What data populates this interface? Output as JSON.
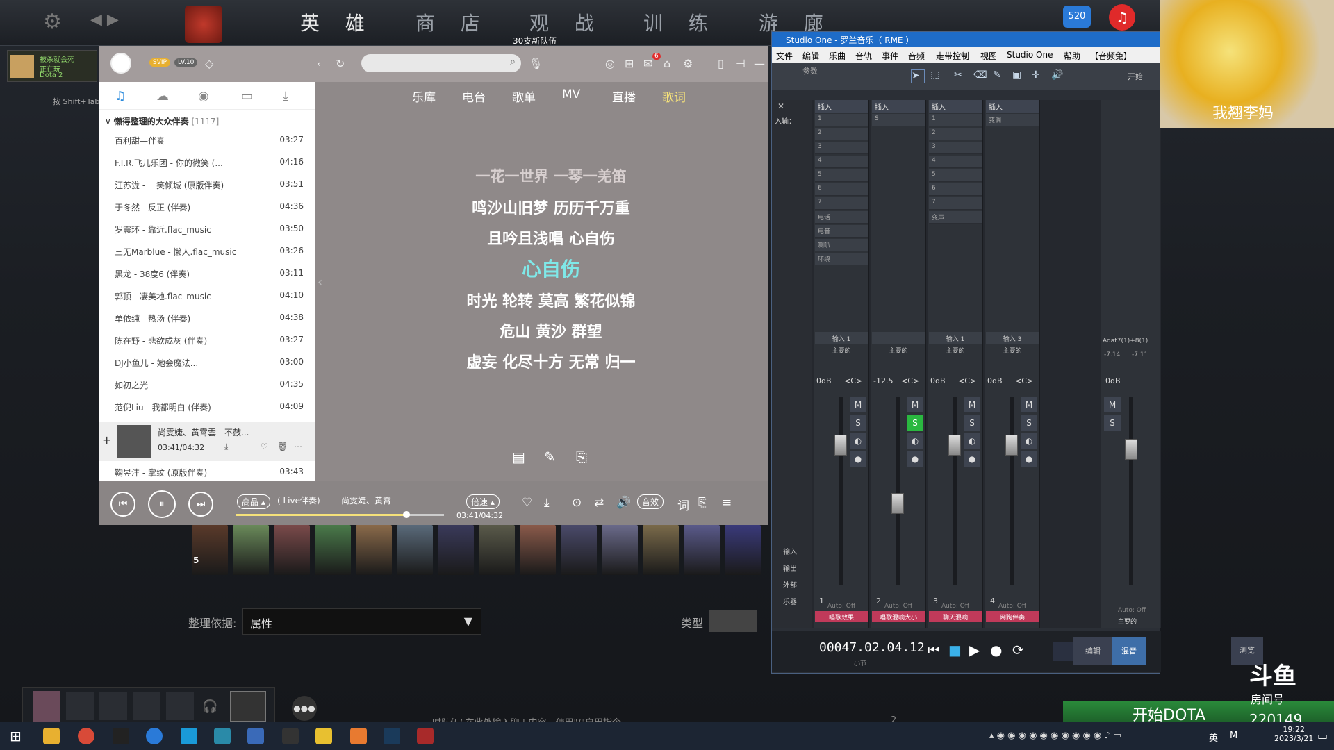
{
  "game": {
    "tabs": [
      "英 雄",
      "商 店",
      "观 战",
      "训 练",
      "游 廊"
    ],
    "player": {
      "line1": "被杀就会死",
      "line2": "正在玩",
      "line3": "Dota 2"
    },
    "shift_tab": "按 Shift+Tab 键",
    "news_badge": "30支新队伍",
    "sort_label": "整理依据:",
    "sort_value": "属性",
    "type_label": "类型",
    "chat_hint": "时队伍/ 在此处输入聊天内容，使用\"/\"启用指令",
    "start_button": "开始DOTA",
    "hero_count_badge": "5",
    "party_counts": [
      "2"
    ]
  },
  "stream": {
    "webcam_caption": "我翘李妈",
    "watermark": "斗鱼",
    "room_label": "房间号",
    "room_no": "220149",
    "badge_520": "520"
  },
  "music": {
    "header": {
      "svip": "SVIP",
      "level": "LV.10",
      "notif_count": "6"
    },
    "nav": [
      "乐库",
      "电台",
      "歌单",
      "MV",
      "直播",
      "歌词"
    ],
    "nav_active": 5,
    "playlist_title": "懒得整理的大众伴奏",
    "playlist_count": "[1117]",
    "songs": [
      {
        "name": "百利甜—伴奏",
        "dur": "03:27"
      },
      {
        "name": "F.I.R.飞儿乐团 - 你的微笑 (...",
        "dur": "04:16"
      },
      {
        "name": "汪苏泷 - 一笑倾城 (原版伴奏)",
        "dur": "03:51"
      },
      {
        "name": "于冬然 - 反正 (伴奏)",
        "dur": "04:36"
      },
      {
        "name": "罗震环 - 靠近.flac_music",
        "dur": "03:50"
      },
      {
        "name": "三无Marblue - 懒人.flac_music",
        "dur": "03:26"
      },
      {
        "name": "黑龙 - 38度6 (伴奏)",
        "dur": "03:11"
      },
      {
        "name": "郭顶 - 凄美地.flac_music",
        "dur": "04:10"
      },
      {
        "name": "单依纯 - 热汤 (伴奏)",
        "dur": "04:38"
      },
      {
        "name": "陈在野 - 悲欲成灰 (伴奏)",
        "dur": "03:27"
      },
      {
        "name": "DJ小鱼儿 - 她会魔法...",
        "dur": "03:00"
      },
      {
        "name": "如初之光",
        "dur": "04:35"
      },
      {
        "name": "范倪Liu - 我都明白 (伴奏)",
        "dur": "04:09"
      }
    ],
    "now_playing": {
      "name": "尚雯婕、黄霄雲 - 不鼓...",
      "time": "03:41/04:32"
    },
    "last_song": {
      "name": "鞠昱沣 - 掌纹 (原版伴奏)",
      "dur": "03:43"
    },
    "lyrics": [
      "一花一世界 一琴一羌笛",
      "鸣沙山旧梦 历历千万重",
      "且吟且浅唱 心自伤",
      "心自伤",
      "时光 轮转 莫高 繁花似锦",
      "危山 黄沙 群望",
      "虚妄 化尽十方 无常 归一"
    ],
    "player": {
      "quality": "高品 ▴",
      "title": "( Live伴奏)",
      "artist": "尚雯婕、黄霄",
      "speed": "倍速 ▴",
      "time": "03:41/04:32",
      "sound_fx": "音效",
      "lyric_btn": "词",
      "progress": 0.82
    }
  },
  "studio": {
    "title": "Studio One - 罗兰音乐（ RME ）",
    "menu": [
      "文件",
      "编辑",
      "乐曲",
      "音轨",
      "事件",
      "音频",
      "走带控制",
      "视图",
      "Studio One",
      "帮助",
      "【音频兔】"
    ],
    "param_label": "参数",
    "start_label": "开始",
    "side_labels": [
      "入输：",
      "输入",
      "输出",
      "外部",
      "乐器"
    ],
    "channels": [
      {
        "insert": "插入",
        "slots": [
          "1",
          "2",
          "3",
          "4",
          "5",
          "6",
          "7",
          "电话",
          "电音",
          "喇叭",
          "环绕"
        ],
        "input": "输入 1",
        "route": "主要的",
        "db": "0dB",
        "pan": "<C>",
        "num": "1",
        "auto": "Auto: Off",
        "name": "唱歌效果",
        "solo": false
      },
      {
        "insert": "插入",
        "slots": [
          "S"
        ],
        "input": "",
        "route": "主要的",
        "db": "-12.5",
        "pan": "<C>",
        "num": "2",
        "auto": "Auto: Off",
        "name": "唱歌混响大小",
        "solo": true
      },
      {
        "insert": "插入",
        "slots": [
          "1",
          "2",
          "3",
          "4",
          "5",
          "6",
          "7",
          "变声"
        ],
        "input": "输入 1",
        "route": "主要的",
        "db": "0dB",
        "pan": "<C>",
        "num": "3",
        "auto": "Auto: Off",
        "name": "聊天混响",
        "solo": false
      },
      {
        "insert": "插入",
        "slots": [
          "变调"
        ],
        "input": "输入 3",
        "route": "主要的",
        "db": "0dB",
        "pan": "<C>",
        "num": "4",
        "auto": "Auto: Off",
        "name": "网狗伴奏",
        "solo": false
      }
    ],
    "master": {
      "name": "Adat7(1)+8(1)",
      "left": "-7.14",
      "right": "-7.11",
      "db": "0dB",
      "auto": "Auto: Off",
      "label": "主要的"
    },
    "timecode": "00047.02.04.12",
    "timecode_unit": "小节",
    "views": [
      "编辑",
      "混音",
      "浏览"
    ],
    "view_active": 1
  },
  "taskbar": {
    "time": "19:22",
    "date": "2023/3/21",
    "ime": "英",
    "ime2": "M"
  }
}
